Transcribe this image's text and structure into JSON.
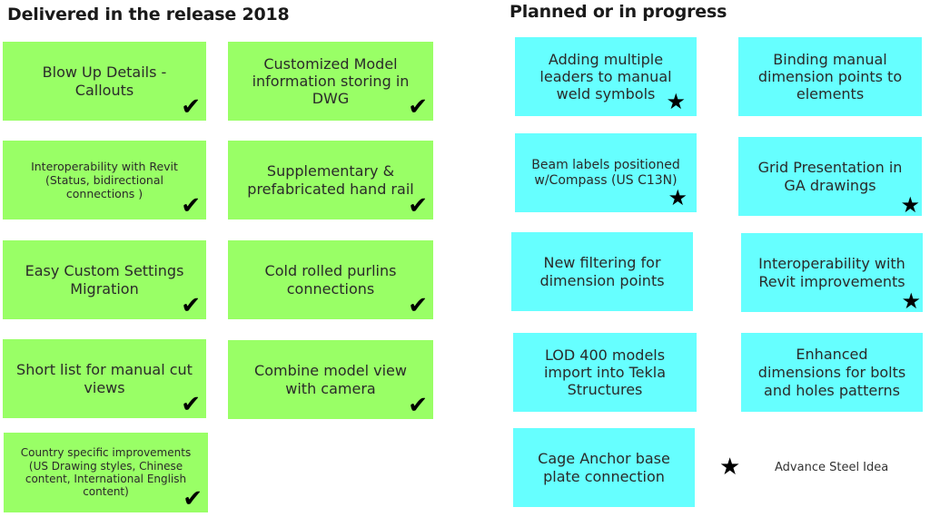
{
  "delivered": {
    "title": "Delivered in the release 2018",
    "color": "#99ff66",
    "status_mark": "✔",
    "items": [
      {
        "label": "Blow Up Details - Callouts"
      },
      {
        "label": "Customized Model information storing in DWG"
      },
      {
        "label": "Interoperability with Revit (Status, bidirectional connections )"
      },
      {
        "label": "Supplementary & prefabricated hand rail"
      },
      {
        "label": "Easy Custom Settings Migration"
      },
      {
        "label": "Cold rolled purlins connections"
      },
      {
        "label": "Short list for manual cut views"
      },
      {
        "label": "Combine model view with camera"
      },
      {
        "label": "Country specific improvements (US Drawing styles, Chinese content, International English content)"
      }
    ]
  },
  "planned": {
    "title": "Planned or in progress",
    "color": "#66ffff",
    "idea_mark": "★",
    "items": [
      {
        "label": "Adding multiple leaders to manual weld symbols",
        "advance_steel_idea": true
      },
      {
        "label": "Binding manual dimension points to elements",
        "advance_steel_idea": false
      },
      {
        "label": "Beam labels positioned w/Compass (US C13N)",
        "advance_steel_idea": true
      },
      {
        "label": "Grid Presentation in GA drawings",
        "advance_steel_idea": true
      },
      {
        "label": "New filtering for dimension points",
        "advance_steel_idea": false
      },
      {
        "label": "Interoperability with Revit improvements",
        "advance_steel_idea": true
      },
      {
        "label": "LOD 400 models import into Tekla Structures",
        "advance_steel_idea": false
      },
      {
        "label": "Enhanced dimensions for bolts and holes patterns",
        "advance_steel_idea": false
      },
      {
        "label": "Cage Anchor base plate connection",
        "advance_steel_idea": false
      }
    ]
  },
  "legend": {
    "icon": "★",
    "label": "Advance Steel Idea"
  }
}
